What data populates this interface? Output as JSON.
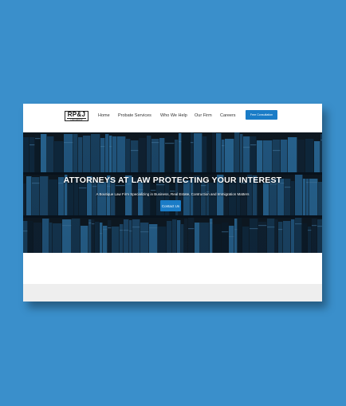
{
  "logo": {
    "main": "RP&J",
    "sub": "LAW GROUP"
  },
  "nav": {
    "items": [
      "Home",
      "Probate Services",
      "Who We Help",
      "Our Firm",
      "Careers"
    ],
    "cta_label": "Free Consultation"
  },
  "hero": {
    "title": "ATTORNEYS AT LAW PROTECTING YOUR INTEREST",
    "subtitle": "A Boutique Law Firm Specializing in Business, Real Estate, Contruction and Immigration Matters",
    "button_label": "Contact Us"
  },
  "colors": {
    "background": "#3a8fcb",
    "accent": "#1a7cc7",
    "hero_tint": "#1e5f8f"
  }
}
